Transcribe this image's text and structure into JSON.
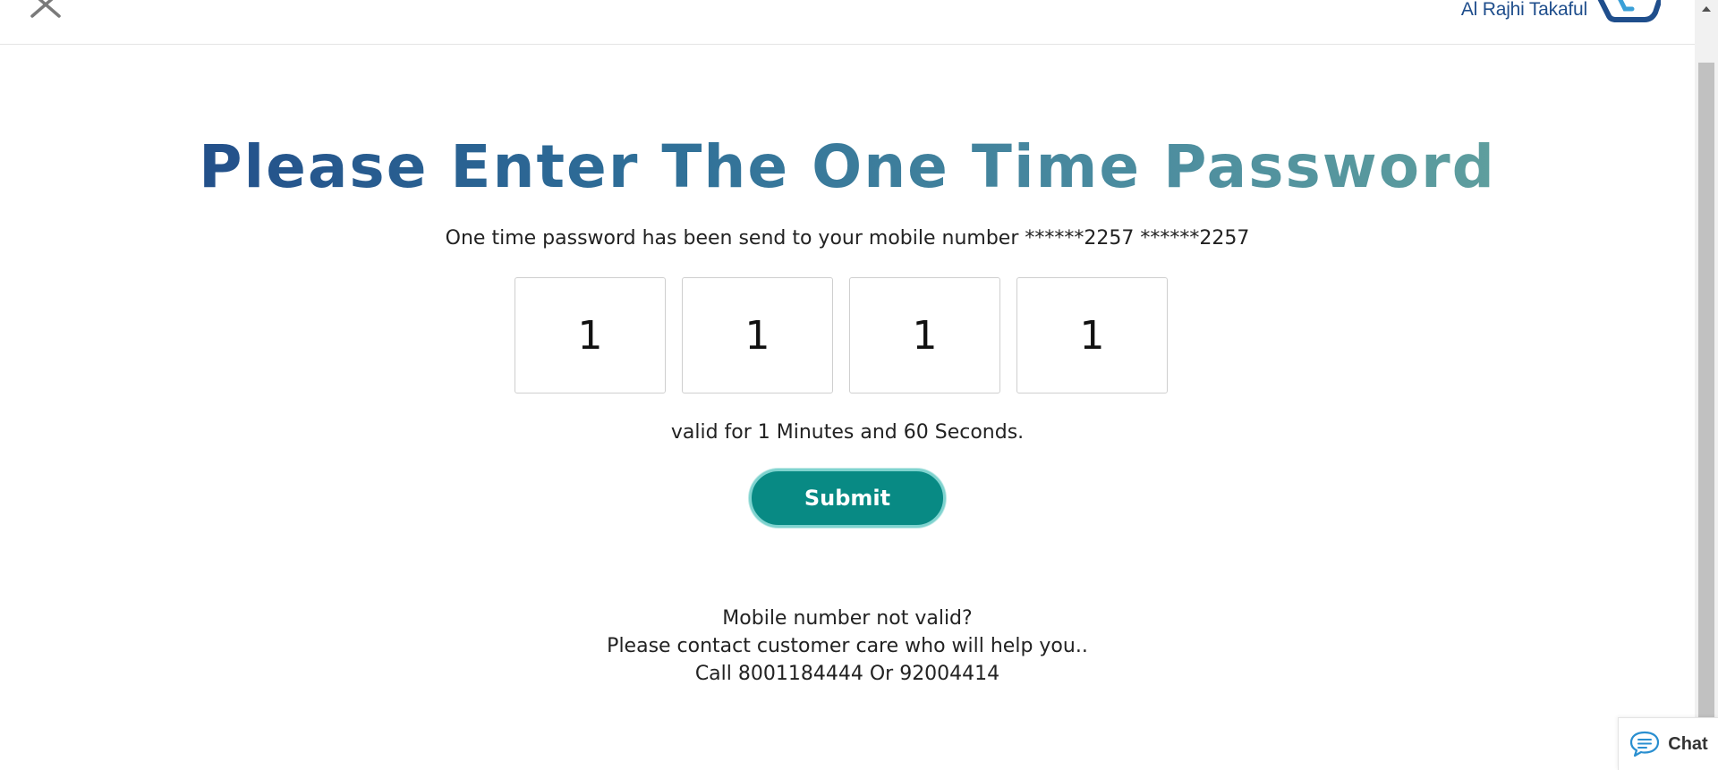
{
  "header": {
    "close_icon": "close-icon",
    "logo_text": "Al Rajhi Takaful",
    "logo_icon": "al-rajhi-logo-mark",
    "brand_color": "#1f4e8c"
  },
  "main": {
    "title": "Please Enter The One Time Password",
    "subtitle": "One time password has been send to your mobile number ******2257  ******2257",
    "otp_digits": [
      "1",
      "1",
      "1",
      "1"
    ],
    "validity": "valid for 1 Minutes and 60 Seconds.",
    "submit_label": "Submit",
    "submit_color": "#088a84",
    "contact_line1": "Mobile number not valid?",
    "contact_line2": "Please contact customer care who will help you..",
    "contact_line3": "Call 8001184444 Or 92004414"
  },
  "chat": {
    "label": "Chat",
    "icon": "chat-bubble-icon"
  }
}
